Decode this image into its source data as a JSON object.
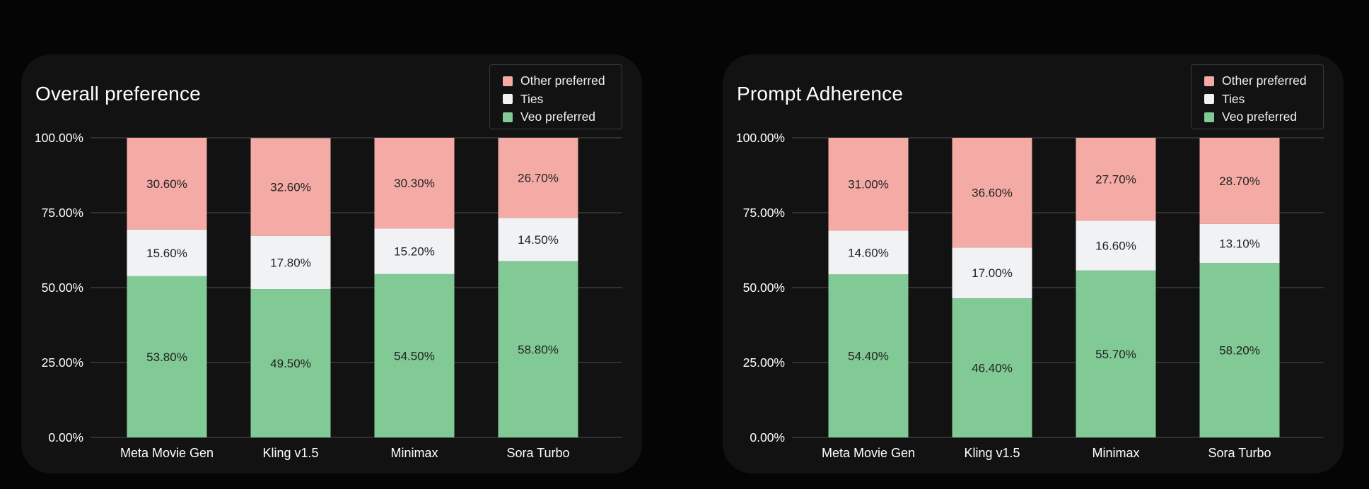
{
  "colors": {
    "other": "#f4aba6",
    "ties": "#f1f2f4",
    "veo": "#81c995",
    "grid": "#3a3a3a",
    "panel_bg": "#121212",
    "page_bg": "#050505",
    "text": "#ffffff",
    "bar_text": "#222222"
  },
  "chart_data": [
    {
      "type": "bar",
      "stacked": true,
      "title": "Overall preference",
      "xlabel": "",
      "ylabel": "",
      "ylim": [
        0,
        100
      ],
      "yticks": [
        "0.00%",
        "25.00%",
        "50.00%",
        "75.00%",
        "100.00%"
      ],
      "ytick_values": [
        0,
        25,
        50,
        75,
        100
      ],
      "grid": true,
      "legend_position": "top-right",
      "categories": [
        "Meta Movie Gen",
        "Kling v1.5",
        "Minimax",
        "Sora Turbo"
      ],
      "series": [
        {
          "name": "Veo preferred",
          "key": "veo",
          "values": [
            53.8,
            49.5,
            54.5,
            58.8
          ],
          "labels": [
            "53.80%",
            "49.50%",
            "54.50%",
            "58.80%"
          ]
        },
        {
          "name": "Ties",
          "key": "ties",
          "values": [
            15.6,
            17.8,
            15.2,
            14.5
          ],
          "labels": [
            "15.60%",
            "17.80%",
            "15.20%",
            "14.50%"
          ]
        },
        {
          "name": "Other preferred",
          "key": "other",
          "values": [
            30.6,
            32.6,
            30.3,
            26.7
          ],
          "labels": [
            "30.60%",
            "32.60%",
            "30.30%",
            "26.70%"
          ]
        }
      ],
      "legend": [
        "Other preferred",
        "Ties",
        "Veo preferred"
      ]
    },
    {
      "type": "bar",
      "stacked": true,
      "title": "Prompt Adherence",
      "xlabel": "",
      "ylabel": "",
      "ylim": [
        0,
        100
      ],
      "yticks": [
        "0.00%",
        "25.00%",
        "50.00%",
        "75.00%",
        "100.00%"
      ],
      "ytick_values": [
        0,
        25,
        50,
        75,
        100
      ],
      "grid": true,
      "legend_position": "top-right",
      "categories": [
        "Meta Movie Gen",
        "Kling v1.5",
        "Minimax",
        "Sora Turbo"
      ],
      "series": [
        {
          "name": "Veo preferred",
          "key": "veo",
          "values": [
            54.4,
            46.4,
            55.7,
            58.2
          ],
          "labels": [
            "54.40%",
            "46.40%",
            "55.70%",
            "58.20%"
          ]
        },
        {
          "name": "Ties",
          "key": "ties",
          "values": [
            14.6,
            17.0,
            16.6,
            13.1
          ],
          "labels": [
            "14.60%",
            "17.00%",
            "16.60%",
            "13.10%"
          ]
        },
        {
          "name": "Other preferred",
          "key": "other",
          "values": [
            31.0,
            36.6,
            27.7,
            28.7
          ],
          "labels": [
            "31.00%",
            "36.60%",
            "27.70%",
            "28.70%"
          ]
        }
      ],
      "legend": [
        "Other preferred",
        "Ties",
        "Veo preferred"
      ]
    }
  ]
}
